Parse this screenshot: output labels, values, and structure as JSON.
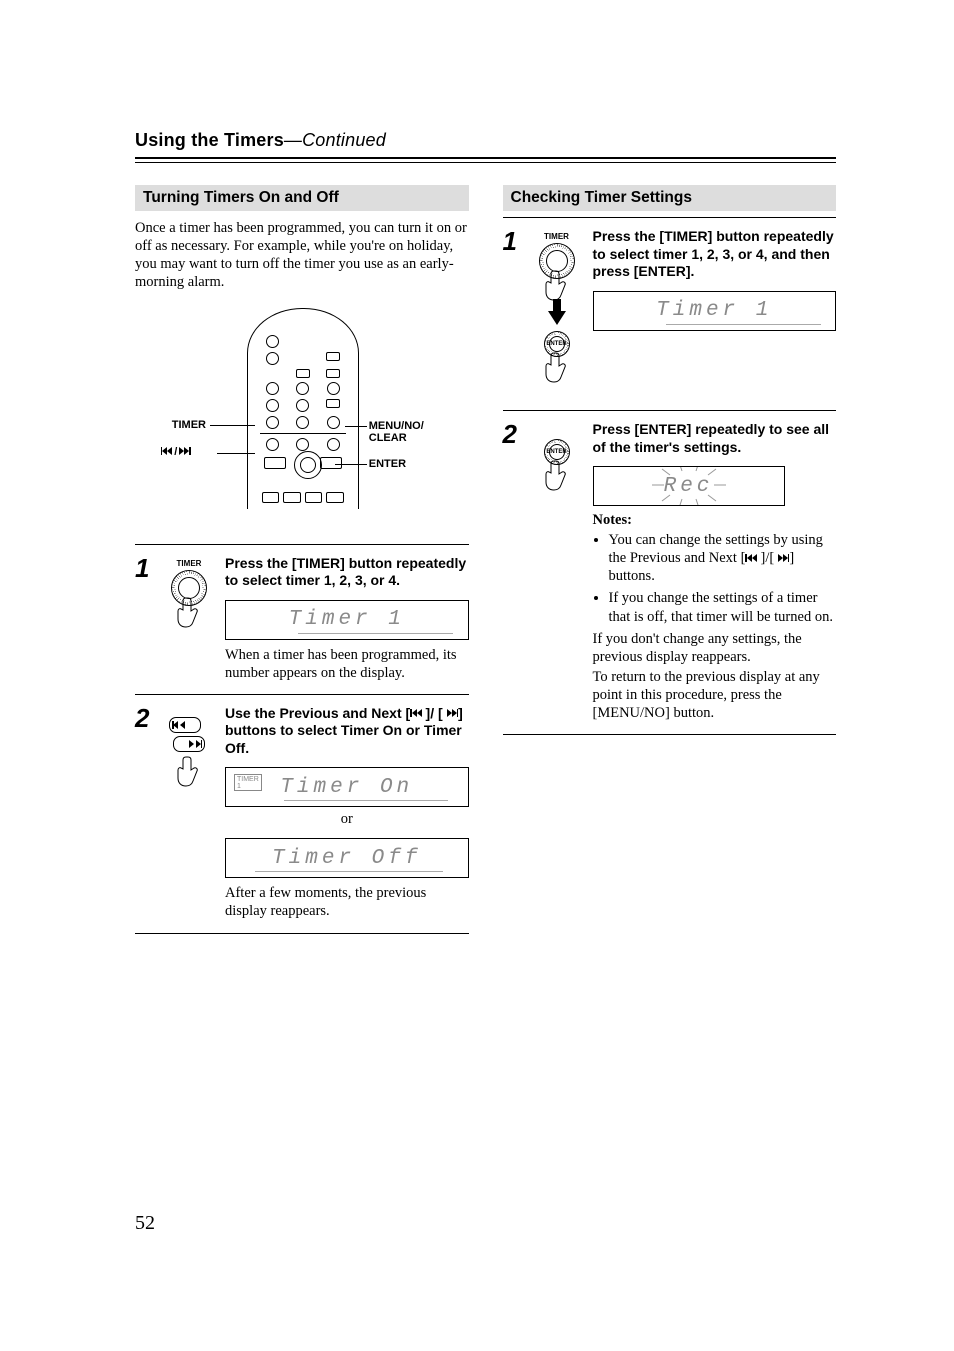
{
  "header": {
    "title": "Using the Timers",
    "continued": "—Continued"
  },
  "left": {
    "section_title": "Turning Timers On and Off",
    "intro": "Once a timer has been programmed, you can turn it on or off as necessary. For example, while you're on holiday, you may want to turn off the timer you use as an early-morning alarm.",
    "remote_labels": {
      "timer": "TIMER",
      "prevnext": "/",
      "menu": "MENU/NO/\nCLEAR",
      "enter": "ENTER"
    },
    "step1": {
      "num": "1",
      "icon_label": "TIMER",
      "instr": "Press the [TIMER] button repeatedly to select timer 1, 2, 3, or 4.",
      "lcd": "Timer  1",
      "after": "When a timer has been programmed, its number appears on the display."
    },
    "step2": {
      "num": "2",
      "instr_a": "Use the Previous and Next [",
      "instr_b": " ]/ [ ",
      "instr_c": "] buttons to select Timer On or Timer Off.",
      "lcd_on": "Timer  On",
      "badge": "TIMER\n1",
      "or": "or",
      "lcd_off": "Timer Off",
      "after": "After a few moments, the previous display reappears."
    }
  },
  "right": {
    "section_title": "Checking Timer Settings",
    "step1": {
      "num": "1",
      "icon_label": "TIMER",
      "enter_label": "ENTER",
      "instr": "Press the [TIMER] button repeatedly to select timer 1, 2, 3, or 4, and then press [ENTER].",
      "lcd": "Timer  1"
    },
    "step2": {
      "num": "2",
      "enter_label": "ENTER",
      "instr": "Press [ENTER] repeatedly to see all of the timer's settings.",
      "lcd": "Rec",
      "notes_head": "Notes:",
      "note1a": "You can change the settings by using the Previous and Next [",
      "note1b": " ]/[ ",
      "note1c": "] buttons.",
      "note2": "If you change the settings of a timer that is off, that timer will be turned on.",
      "tail1": "If you don't change any settings, the previous display reappears.",
      "tail2": "To return to the previous display at any point in this procedure, press the [MENU/NO] button."
    }
  },
  "page_number": "52"
}
